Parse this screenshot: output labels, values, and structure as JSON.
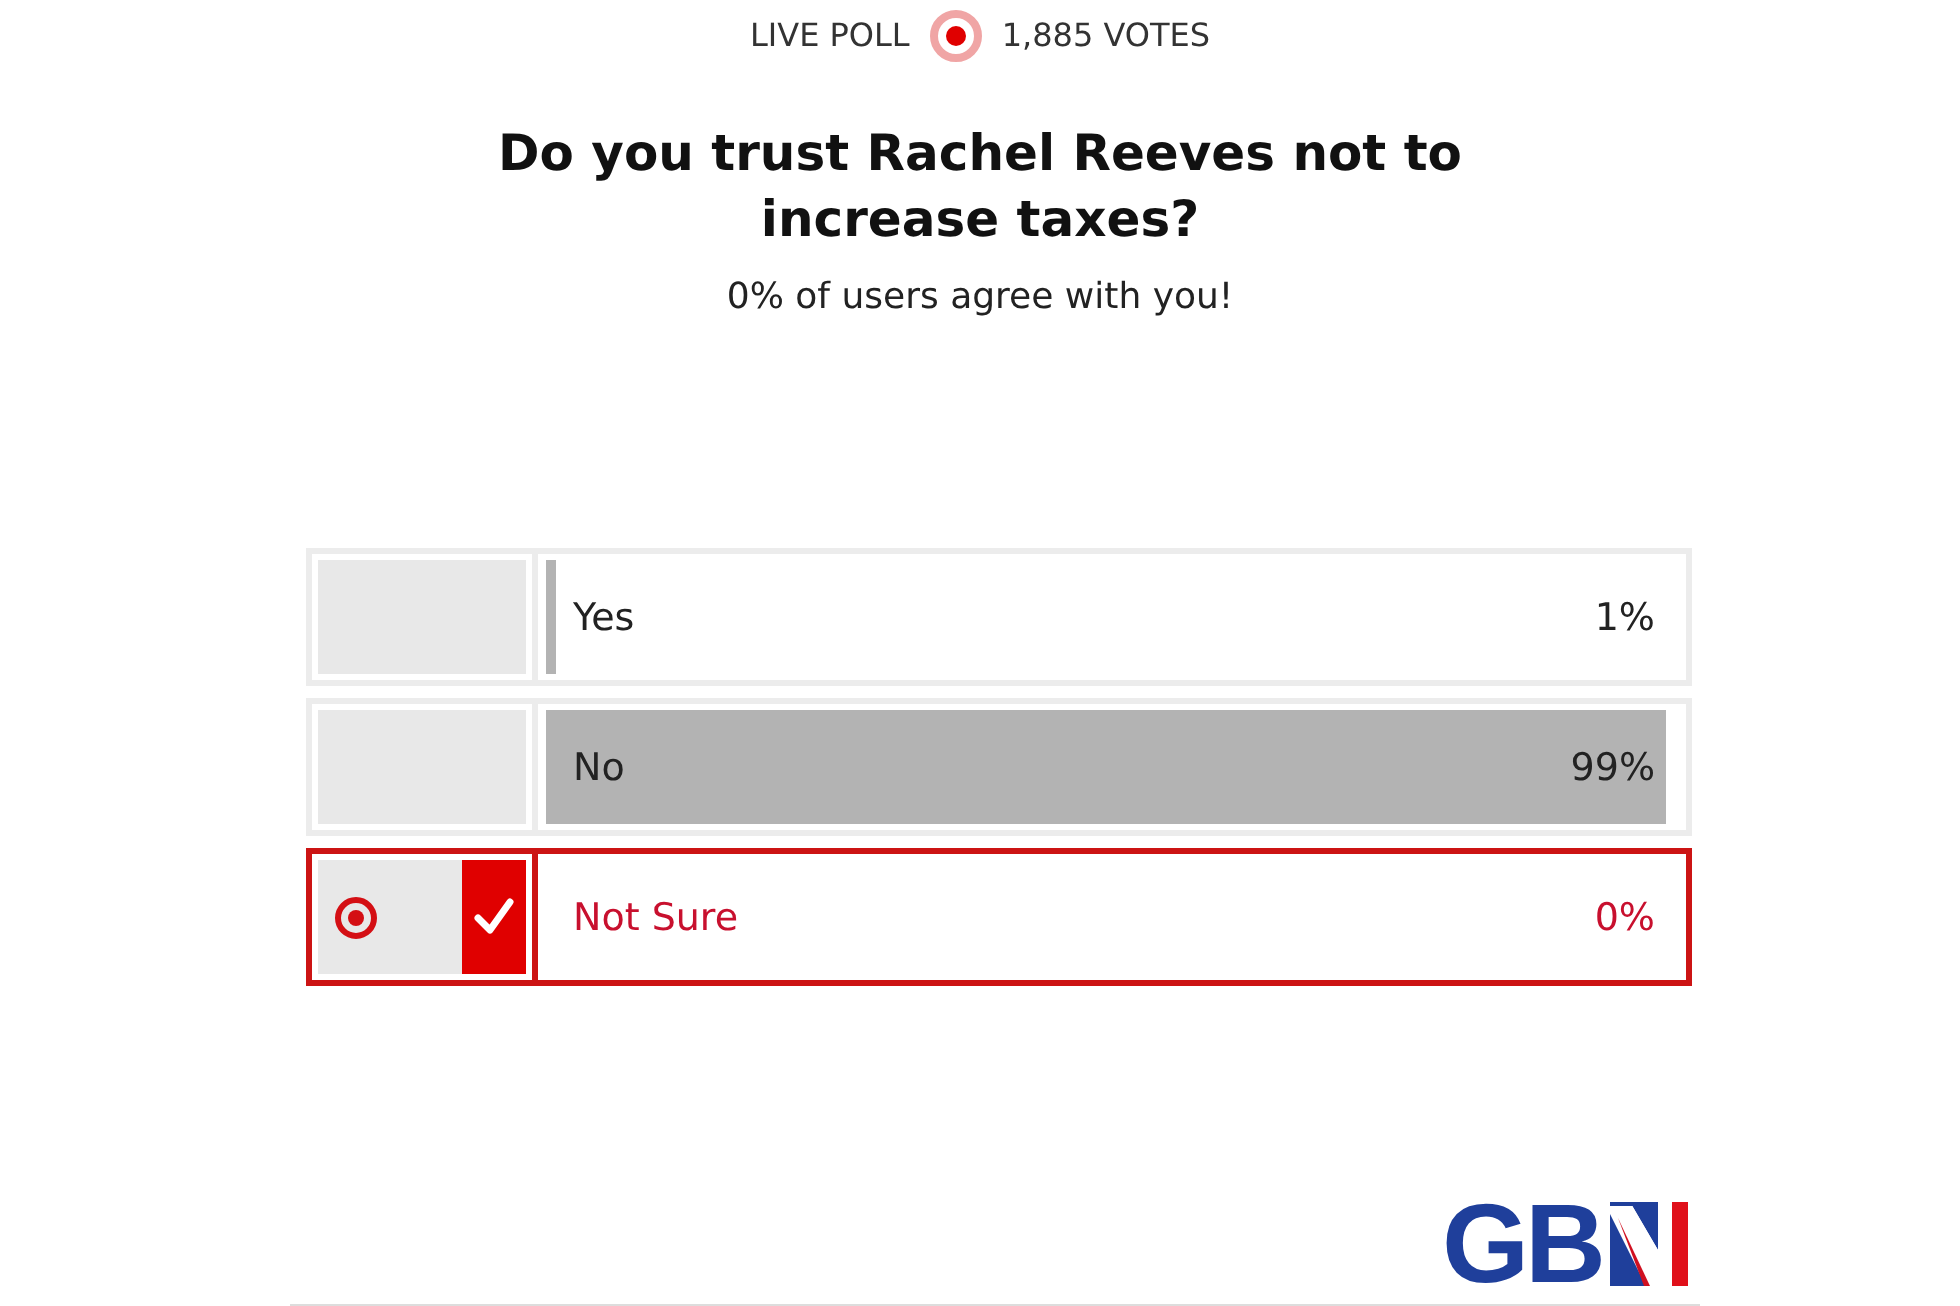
{
  "header": {
    "label": "LIVE POLL",
    "votes": "1,885 VOTES"
  },
  "question": "Do you trust Rachel Reeves not to increase taxes?",
  "result_message": "0% of users agree with you!",
  "options": [
    {
      "label": "Yes",
      "percent": "1%",
      "level": 0.01,
      "selected": false
    },
    {
      "label": "No",
      "percent": "99%",
      "level": 0.99,
      "selected": false
    },
    {
      "label": "Not Sure",
      "percent": "0%",
      "selected": true
    }
  ],
  "logo": {
    "text": "GB"
  }
}
